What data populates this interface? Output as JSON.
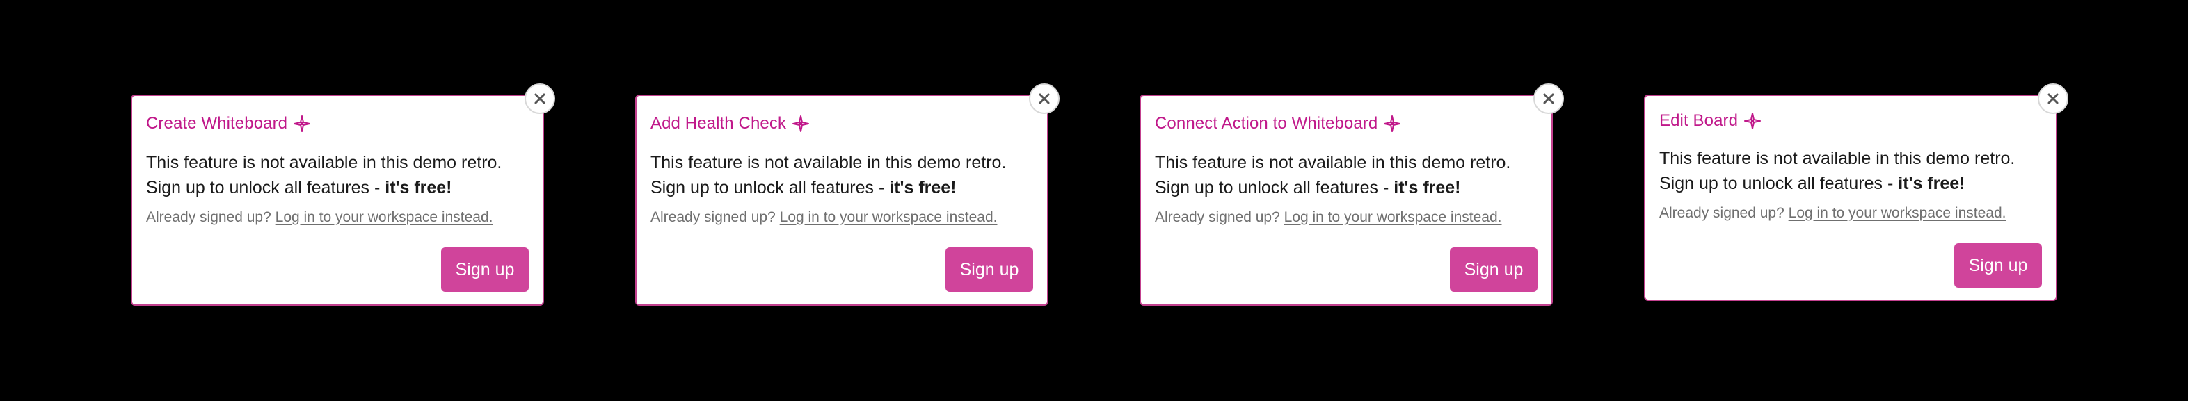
{
  "colors": {
    "accent": "#c0188a",
    "button": "#d0449b",
    "border": "#c3418f",
    "background": "#000000"
  },
  "icons": {
    "title_icon": "sparkle-icon",
    "close_icon": "close-icon"
  },
  "shared": {
    "message_line1": "This feature is not available in this demo retro.",
    "message_line2_prefix": "Sign up to unlock all features - ",
    "message_line2_bold": "it's free!",
    "note_prefix": "Already signed up? ",
    "login_link": "Log in to your workspace instead.",
    "signup_label": "Sign up"
  },
  "dialogs": [
    {
      "title": "Create Whiteboard"
    },
    {
      "title": "Add Health Check"
    },
    {
      "title": "Connect Action to Whiteboard"
    },
    {
      "title": "Edit Board"
    }
  ]
}
